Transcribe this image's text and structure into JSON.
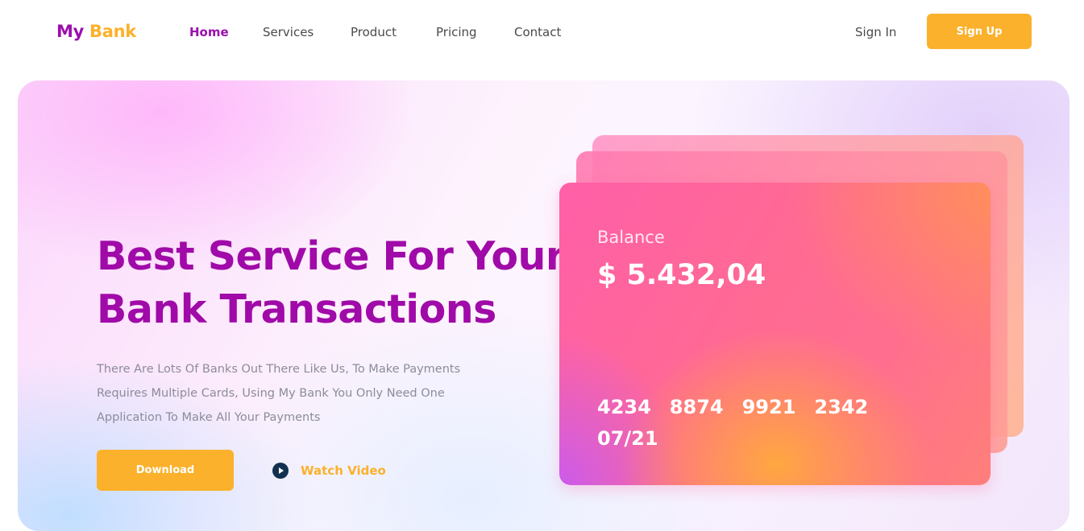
{
  "brand": {
    "logo_part1": "My",
    "logo_part2": "Bank"
  },
  "nav": {
    "links": [
      {
        "label": "Home",
        "active": true
      },
      {
        "label": "Services"
      },
      {
        "label": "Product"
      },
      {
        "label": "Pricing"
      },
      {
        "label": "Contact"
      }
    ],
    "sign_in": "Sign In",
    "sign_up": "Sign Up"
  },
  "hero": {
    "headline_line1": "Best Service For Your",
    "headline_line2": "Bank Transactions",
    "description_lines": [
      "There Are Lots Of Banks Out There Like Us, To Make Payments",
      "Requires Multiple Cards, Using My Bank You Only Need One",
      "Application To Make All Your Payments"
    ],
    "download_label": "Download",
    "watch_video_label": "Watch Video"
  },
  "card": {
    "balance_label": "Balance",
    "balance_amount": "$ 5.432,04",
    "number_groups": [
      "4234",
      "8874",
      "9921",
      "2342"
    ],
    "expiry": "07/21"
  },
  "colors": {
    "brand_purple": "#9b0fae",
    "brand_orange": "#fbb12b",
    "headline_purple": "#a00aa8",
    "play_icon_navy": "#12304f",
    "card_pink": "#ff6a93"
  },
  "icons": {
    "watch_video": "play-circle-icon"
  }
}
